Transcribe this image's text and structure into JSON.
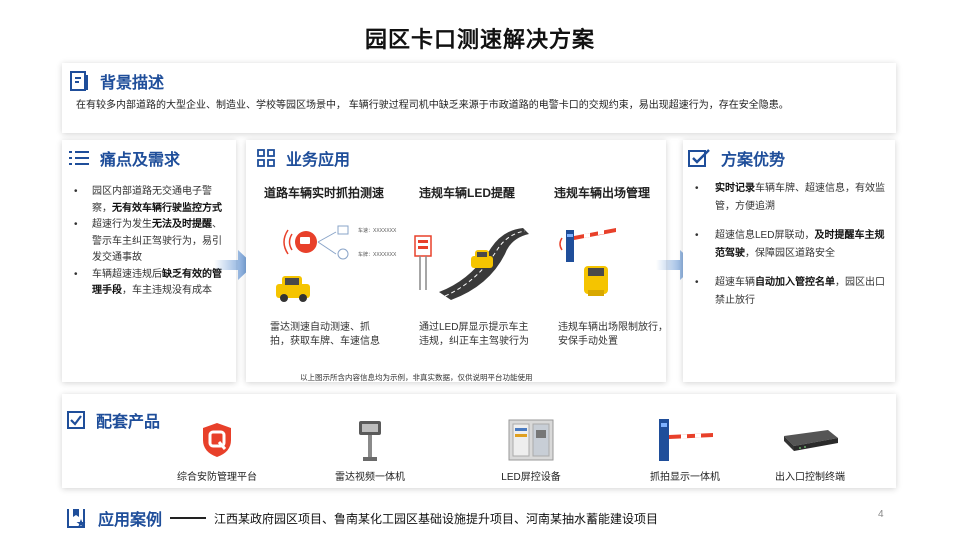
{
  "title": "园区卡口测速解决方案",
  "background": {
    "heading": "背景描述",
    "text": "在有较多内部道路的大型企业、制造业、学校等园区场景中， 车辆行驶过程司机中缺乏来源于市政道路的电警卡口的交规约束，易出现超速行为，存在安全隐患。"
  },
  "pain": {
    "heading": "痛点及需求",
    "items": [
      {
        "a": "园区内部道路无交通电子警察，",
        "b": "无有效车辆行驶监控方式",
        "c": ""
      },
      {
        "a": "超速行为发生",
        "b": "无法及时提醒",
        "c": "、警示车主纠正驾驶行为，易引发交通事故"
      },
      {
        "a": "车辆超速违规后",
        "b": "缺乏有效的管理手段",
        "c": "，车主违规没有成本"
      }
    ]
  },
  "business": {
    "heading": "业务应用",
    "columns": [
      {
        "title": "道路车辆实时抓拍测速",
        "desc": "雷达测速自动测速、抓拍，获取车牌、车速信息"
      },
      {
        "title": "违规车辆LED提醒",
        "desc": "通过LED屏显示提示车主违规，纠正车主驾驶行为"
      },
      {
        "title": "违规车辆出场管理",
        "desc": "违规车辆出场限制放行，安保手动处置"
      }
    ],
    "tag1": "车速：XXXXXXX",
    "tag2": "车牌：XXXXXXX",
    "note": "以上图示所含内容信息均为示例，非真实数据，仅供说明平台功能使用"
  },
  "advantages": {
    "heading": "方案优势",
    "items": [
      {
        "b": "实时记录",
        "c": "车辆车牌、超速信息，有效监管，方便追溯",
        "b2": "",
        "c2": ""
      },
      {
        "b": "",
        "c": "超速信息LED屏联动，",
        "b2": "及时提醒车主规范驾驶",
        "c2": "，保障园区道路安全"
      },
      {
        "b": "",
        "c": "超速车辆",
        "b2": "自动加入管控名单",
        "c2": "，园区出口禁止放行"
      }
    ]
  },
  "products": {
    "heading": "配套产品",
    "items": [
      {
        "label": "综合安防管理平台"
      },
      {
        "label": "雷达视频一体机"
      },
      {
        "label": "LED屏控设备"
      },
      {
        "label": "抓拍显示一体机"
      },
      {
        "label": "出入口控制终端"
      }
    ]
  },
  "cases": {
    "heading": "应用案例",
    "text": "江西某政府园区项目、鲁南某化工园区基础设施提升项目、河南某抽水蓄能建设项目"
  },
  "page_number": "4",
  "colors": {
    "accent": "#1f4e9a",
    "arrow": "#5b8fd1",
    "car": "#f5c400",
    "alert": "#e8402a"
  }
}
